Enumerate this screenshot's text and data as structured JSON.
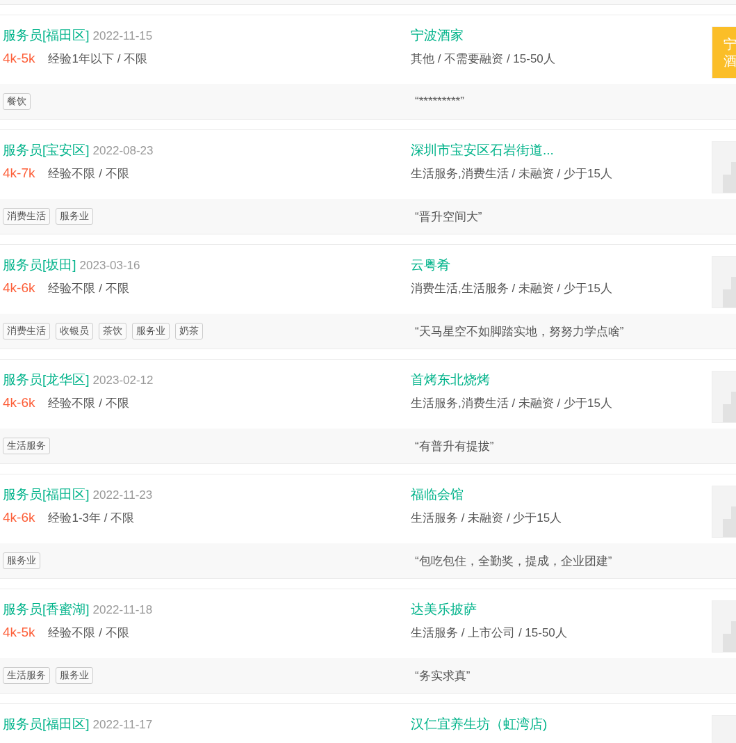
{
  "jobs": [
    {
      "title": "服务员[福田区]",
      "date": "2022-11-15",
      "salary": "4k-5k",
      "requirement": "经验1年以下 / 不限",
      "company": "宁波酒家",
      "company_info": "其他 / 不需要融资 / 15-50人",
      "logo": {
        "kind": "text",
        "lines": [
          "宁",
          "酒"
        ]
      },
      "tags": [
        "餐饮"
      ],
      "quote": "“*********”"
    },
    {
      "title": "服务员[宝安区]",
      "date": "2022-08-23",
      "salary": "4k-7k",
      "requirement": "经验不限 / 不限",
      "company": "深圳市宝安区石岩街道...",
      "company_info": "生活服务,消费生活 / 未融资 / 少于15人",
      "logo": {
        "kind": "placeholder"
      },
      "tags": [
        "消费生活",
        "服务业"
      ],
      "quote": "“晋升空间大”"
    },
    {
      "title": "服务员[坂田]",
      "date": "2023-03-16",
      "salary": "4k-6k",
      "requirement": "经验不限 / 不限",
      "company": "云粤肴",
      "company_info": "消费生活,生活服务 / 未融资 / 少于15人",
      "logo": {
        "kind": "placeholder"
      },
      "tags": [
        "消费生活",
        "收银员",
        "茶饮",
        "服务业",
        "奶茶"
      ],
      "quote": "“天马星空不如脚踏实地，努努力学点啥”"
    },
    {
      "title": "服务员[龙华区]",
      "date": "2023-02-12",
      "salary": "4k-6k",
      "requirement": "经验不限 / 不限",
      "company": "首烤东北烧烤",
      "company_info": "生活服务,消费生活 / 未融资 / 少于15人",
      "logo": {
        "kind": "placeholder"
      },
      "tags": [
        "生活服务"
      ],
      "quote": "“有普升有提拔”"
    },
    {
      "title": "服务员[福田区]",
      "date": "2022-11-23",
      "salary": "4k-6k",
      "requirement": "经验1-3年 / 不限",
      "company": "福临会馆",
      "company_info": "生活服务 / 未融资 / 少于15人",
      "logo": {
        "kind": "placeholder"
      },
      "tags": [
        "服务业"
      ],
      "quote": "“包吃包住，全勤奖，提成，企业团建”"
    },
    {
      "title": "服务员[香蜜湖]",
      "date": "2022-11-18",
      "salary": "4k-5k",
      "requirement": "经验不限 / 不限",
      "company": "达美乐披萨",
      "company_info": "生活服务 / 上市公司 / 15-50人",
      "logo": {
        "kind": "placeholder"
      },
      "tags": [
        "生活服务",
        "服务业"
      ],
      "quote": "“务实求真”"
    },
    {
      "title": "服务员[福田区]",
      "date": "2022-11-17",
      "company": "汉仁宜养生坊（虹湾店)",
      "logo": {
        "kind": "blank"
      }
    }
  ]
}
